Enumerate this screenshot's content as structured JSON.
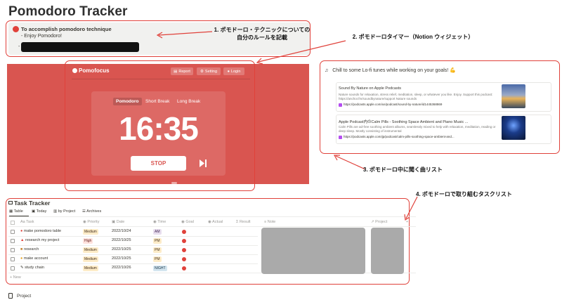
{
  "page": {
    "title": "Pomodoro Tracker"
  },
  "callout": {
    "line1": "To accomplish pomodoro technique",
    "line2": "- Enjoy Pomodoro!",
    "dash": "-"
  },
  "annotations": {
    "a1_line1": "1. ポモドーロ・テクニックについての",
    "a1_line2": "自分のルールを記載",
    "a2": "2. ポモドーロタイマー（Notion ウィジェット）",
    "a3": "3. ポモドーロ中に聞く曲リスト",
    "a4": "4. ポモドーロで取り組むタスクリスト"
  },
  "pomofocus": {
    "logo": "Pomofocus",
    "report": "Report",
    "setting": "Setting",
    "login": "Login",
    "tabs": [
      "Pomodoro",
      "Short Break",
      "Long Break"
    ],
    "timer": "16:35",
    "stop": "STOP",
    "accent": "#d95550"
  },
  "music": {
    "title": "Chill to some Lo-fi tunes while working on your goals! 💪",
    "cards": [
      {
        "title": "Sound By Nature on Apple Podcasts",
        "desc": "Nature sounds for relaxation, stress relief, meditation, sleep, or whatever you like. Enjoy. Support this podcast: https://anchor.fm/soundbynature/support Nature sounds",
        "url": "https://podcasts.apple.com/us/podcast/sound-by-nature/id1445368869"
      },
      {
        "title": "Apple Podcast内のCalm Pills - Soothing Space Ambient and Piano Music ...",
        "desc": "Calm Pills are ad-free soothing ambient albums, seamlessly mixed to help with relaxation, meditation, reading or deep sleep. Mostly consisting of instrumental",
        "url": "https://podcasts.apple.com/jp/podcast/calm-pills-soothing-space-ambient-and..."
      }
    ]
  },
  "tasks": {
    "title": "Task Tracker",
    "views": [
      "Table",
      "Today",
      "by Project",
      "Archives"
    ],
    "columns": [
      "Aa Task",
      "Priority",
      "Date",
      "Time",
      "Goal",
      "Actual",
      "Result",
      "Note",
      "Project"
    ],
    "rows": [
      {
        "task": "make pomodoro table",
        "priority": "Medium",
        "date": "2022/10/24",
        "time": "AM"
      },
      {
        "task": "research my project",
        "priority": "High",
        "date": "2022/10/25",
        "time": "PM"
      },
      {
        "task": "research",
        "priority": "Medium",
        "date": "2022/10/25",
        "time": "PM"
      },
      {
        "task": "make account",
        "priority": "Medium",
        "date": "2022/10/25",
        "time": "PM"
      },
      {
        "task": "study chain",
        "priority": "Medium",
        "date": "2022/10/26",
        "time": "NIGHT"
      }
    ],
    "new": "+ New"
  },
  "footer": {
    "project": "Project"
  }
}
